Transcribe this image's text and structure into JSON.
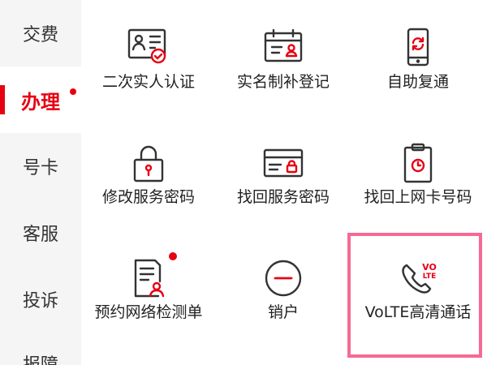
{
  "sidebar": {
    "items": [
      {
        "label": "交费"
      },
      {
        "label": "办理",
        "active": true
      },
      {
        "label": "号卡"
      },
      {
        "label": "客服"
      },
      {
        "label": "投诉"
      },
      {
        "label": "报障"
      }
    ]
  },
  "services": [
    {
      "label": "二次实人认证",
      "icon": "id-card-check-icon"
    },
    {
      "label": "实名制补登记",
      "icon": "calendar-person-icon"
    },
    {
      "label": "自助复通",
      "icon": "phone-refresh-icon"
    },
    {
      "label": "修改服务密码",
      "icon": "padlock-icon"
    },
    {
      "label": "找回服务密码",
      "icon": "card-lock-icon"
    },
    {
      "label": "找回上网卡号码",
      "icon": "clipboard-clock-icon"
    },
    {
      "label": "预约网络检测单",
      "icon": "document-person-icon",
      "badge": true
    },
    {
      "label": "销户",
      "icon": "minus-circle-icon"
    },
    {
      "label": "VoLTE高清通话",
      "icon": "volte-phone-icon",
      "icon_text": [
        "VO",
        "LTE"
      ],
      "highlighted": true
    }
  ],
  "colors": {
    "accent": "#e60012",
    "highlight_border": "#f56a93",
    "icon_stroke": "#333333",
    "sidebar_bg": "#f5f5f5"
  }
}
